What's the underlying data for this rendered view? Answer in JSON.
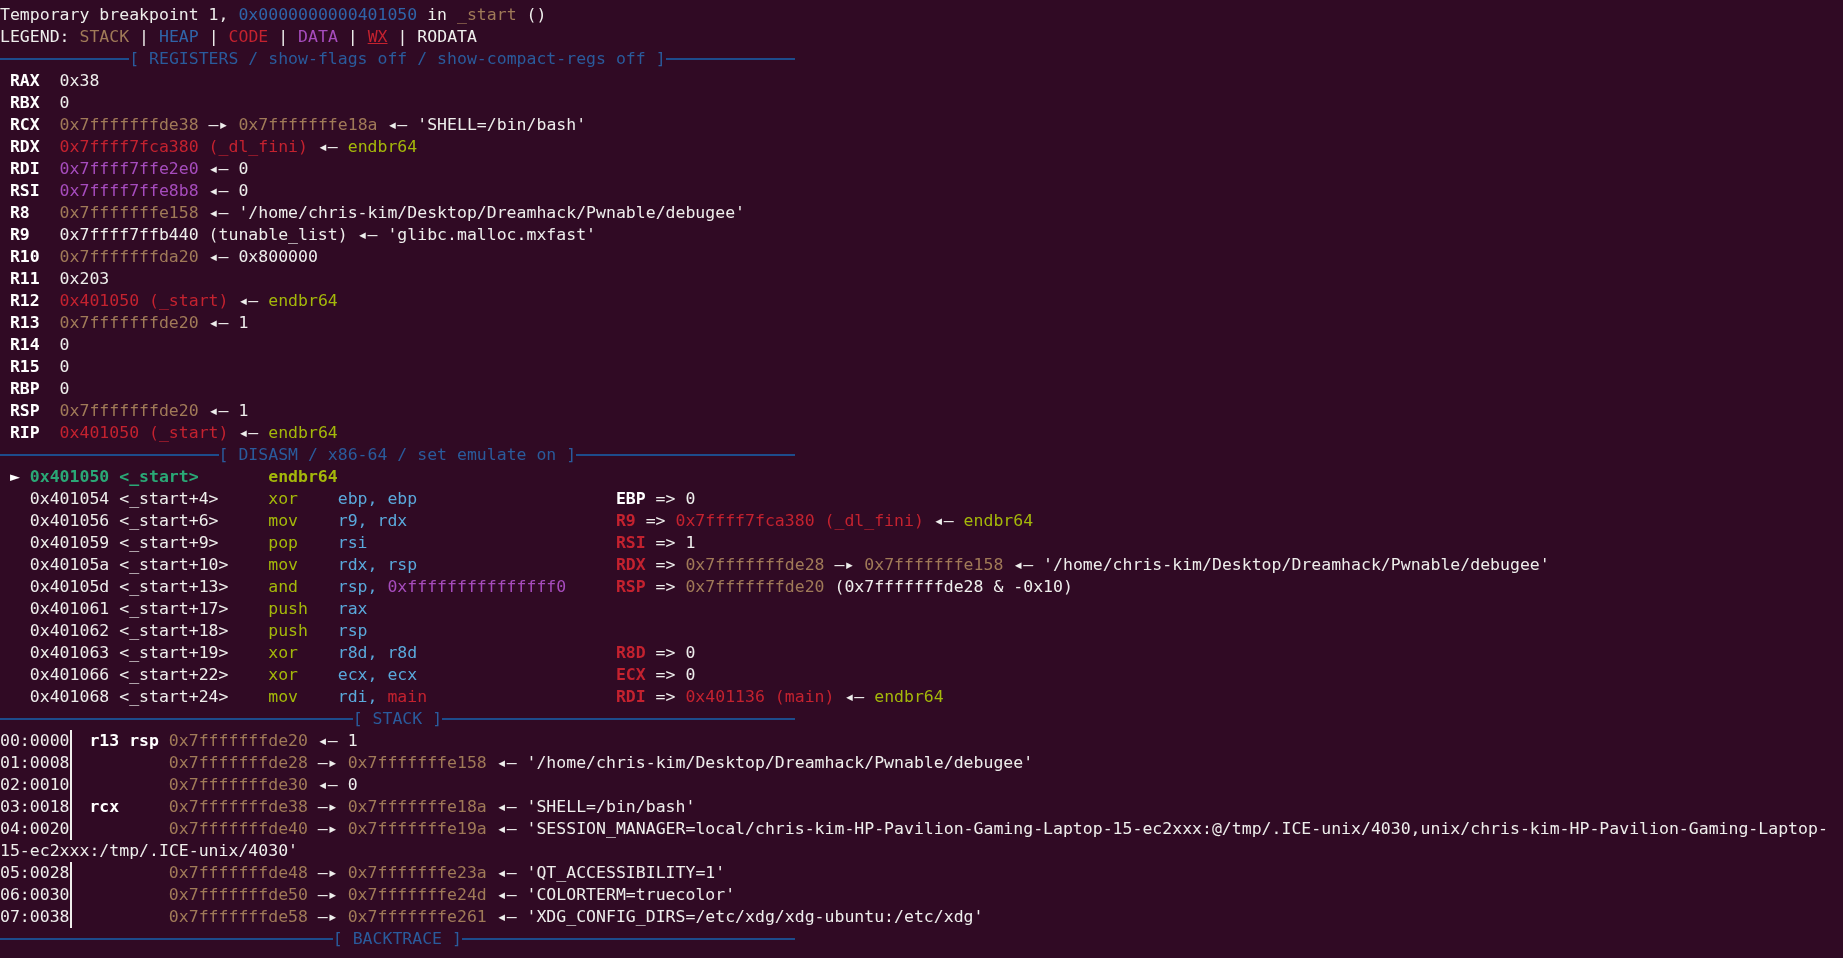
{
  "status_lines": [
    {
      "segments": [
        {
          "kind": "plain",
          "text": "Temporary breakpoint 1, "
        },
        {
          "kind": "heap",
          "text": "0x0000000000401050"
        },
        {
          "kind": "plain",
          "text": " in "
        },
        {
          "kind": "stack",
          "text": "_start"
        },
        {
          "kind": "plain",
          "text": " ()"
        }
      ]
    },
    {
      "segments": [
        {
          "kind": "plain",
          "text": "LEGEND: "
        },
        {
          "kind": "stack",
          "text": "STACK"
        },
        {
          "kind": "plain",
          "text": " | "
        },
        {
          "kind": "heap",
          "text": "HEAP"
        },
        {
          "kind": "plain",
          "text": " | "
        },
        {
          "kind": "code",
          "text": "CODE"
        },
        {
          "kind": "plain",
          "text": " | "
        },
        {
          "kind": "data",
          "text": "DATA"
        },
        {
          "kind": "plain",
          "text": " | "
        },
        {
          "kind": "wx",
          "text": "WX"
        },
        {
          "kind": "plain",
          "text": " | RODATA"
        }
      ]
    }
  ],
  "registers": {
    "title": "[ REGISTERS / show-flags off / show-compact-regs off ]",
    "rows": [
      {
        "name": "RAX",
        "value": [
          {
            "kind": "plain",
            "text": "0x38"
          }
        ]
      },
      {
        "name": "RBX",
        "value": [
          {
            "kind": "plain",
            "text": "0"
          }
        ]
      },
      {
        "name": "RCX",
        "value": [
          {
            "kind": "stack",
            "text": "0x7fffffffde38"
          },
          {
            "kind": "plain",
            "text": " —▸ "
          },
          {
            "kind": "stack",
            "text": "0x7fffffffe18a"
          },
          {
            "kind": "plain",
            "text": " ◂— 'SHELL=/bin/bash'"
          }
        ]
      },
      {
        "name": "RDX",
        "value": [
          {
            "kind": "code",
            "text": "0x7ffff7fca380 (_dl_fini)"
          },
          {
            "kind": "plain",
            "text": " ◂— "
          },
          {
            "kind": "string",
            "text": "endbr64"
          }
        ]
      },
      {
        "name": "RDI",
        "value": [
          {
            "kind": "data",
            "text": "0x7ffff7ffe2e0"
          },
          {
            "kind": "plain",
            "text": " ◂— 0"
          }
        ]
      },
      {
        "name": "RSI",
        "value": [
          {
            "kind": "data",
            "text": "0x7ffff7ffe8b8"
          },
          {
            "kind": "plain",
            "text": " ◂— 0"
          }
        ]
      },
      {
        "name": "R8",
        "value": [
          {
            "kind": "stack",
            "text": "0x7fffffffe158"
          },
          {
            "kind": "plain",
            "text": " ◂— '/home/chris-kim/Desktop/Dreamhack/Pwnable/debugee'"
          }
        ]
      },
      {
        "name": "R9",
        "value": [
          {
            "kind": "plain",
            "text": "0x7ffff7ffb440 (tunable_list) ◂— 'glibc.malloc.mxfast'"
          }
        ]
      },
      {
        "name": "R10",
        "value": [
          {
            "kind": "stack",
            "text": "0x7fffffffda20"
          },
          {
            "kind": "plain",
            "text": " ◂— 0x800000"
          }
        ]
      },
      {
        "name": "R11",
        "value": [
          {
            "kind": "plain",
            "text": "0x203"
          }
        ]
      },
      {
        "name": "R12",
        "value": [
          {
            "kind": "code",
            "text": "0x401050 (_start)"
          },
          {
            "kind": "plain",
            "text": " ◂— "
          },
          {
            "kind": "string",
            "text": "endbr64"
          }
        ]
      },
      {
        "name": "R13",
        "value": [
          {
            "kind": "stack",
            "text": "0x7fffffffde20"
          },
          {
            "kind": "plain",
            "text": " ◂— 1"
          }
        ]
      },
      {
        "name": "R14",
        "value": [
          {
            "kind": "plain",
            "text": "0"
          }
        ]
      },
      {
        "name": "R15",
        "value": [
          {
            "kind": "plain",
            "text": "0"
          }
        ]
      },
      {
        "name": "RBP",
        "value": [
          {
            "kind": "plain",
            "text": "0"
          }
        ]
      },
      {
        "name": "RSP",
        "value": [
          {
            "kind": "stack",
            "text": "0x7fffffffde20"
          },
          {
            "kind": "plain",
            "text": " ◂— 1"
          }
        ]
      },
      {
        "name": "RIP",
        "value": [
          {
            "kind": "code",
            "text": "0x401050 (_start)"
          },
          {
            "kind": "plain",
            "text": " ◂— "
          },
          {
            "kind": "string",
            "text": "endbr64"
          }
        ]
      }
    ]
  },
  "disasm": {
    "title": "[ DISASM / x86-64 / set emulate on ]",
    "rows": [
      {
        "marker": "►",
        "current": true,
        "address": "0x401050",
        "symbol": "<_start>",
        "mnemonic": "endbr64"
      },
      {
        "current": false,
        "address": "0x401054",
        "symbol": "<_start+4>",
        "mnemonic": "xor",
        "operands": [
          {
            "kind": "operand",
            "text": "ebp, ebp"
          }
        ],
        "annotation": [
          {
            "kind": "reg",
            "text": "EBP"
          },
          {
            "kind": "plain",
            "text": " => 0"
          }
        ]
      },
      {
        "current": false,
        "address": "0x401056",
        "symbol": "<_start+6>",
        "mnemonic": "mov",
        "operands": [
          {
            "kind": "operand",
            "text": "r9, rdx"
          }
        ],
        "annotation": [
          {
            "kind": "regchanged",
            "text": "R9"
          },
          {
            "kind": "plain",
            "text": " => "
          },
          {
            "kind": "code",
            "text": "0x7ffff7fca380 (_dl_fini)"
          },
          {
            "kind": "plain",
            "text": " ◂— "
          },
          {
            "kind": "string",
            "text": "endbr64"
          }
        ]
      },
      {
        "current": false,
        "address": "0x401059",
        "symbol": "<_start+9>",
        "mnemonic": "pop",
        "operands": [
          {
            "kind": "operand",
            "text": "rsi"
          }
        ],
        "annotation": [
          {
            "kind": "regchanged",
            "text": "RSI"
          },
          {
            "kind": "plain",
            "text": " => 1"
          }
        ]
      },
      {
        "current": false,
        "address": "0x40105a",
        "symbol": "<_start+10>",
        "mnemonic": "mov",
        "operands": [
          {
            "kind": "operand",
            "text": "rdx, rsp"
          }
        ],
        "annotation": [
          {
            "kind": "regchanged",
            "text": "RDX"
          },
          {
            "kind": "plain",
            "text": " => "
          },
          {
            "kind": "stack",
            "text": "0x7fffffffde28"
          },
          {
            "kind": "plain",
            "text": " —▸ "
          },
          {
            "kind": "stack",
            "text": "0x7fffffffe158"
          },
          {
            "kind": "plain",
            "text": " ◂— '/home/chris-kim/Desktop/Dreamhack/Pwnable/debugee'"
          }
        ]
      },
      {
        "current": false,
        "address": "0x40105d",
        "symbol": "<_start+13>",
        "mnemonic": "and",
        "operands": [
          {
            "kind": "operand",
            "text": "rsp, "
          },
          {
            "kind": "data",
            "text": "0xfffffffffffffff0"
          }
        ],
        "annotation": [
          {
            "kind": "regchanged",
            "text": "RSP"
          },
          {
            "kind": "plain",
            "text": " => "
          },
          {
            "kind": "stack",
            "text": "0x7fffffffde20"
          },
          {
            "kind": "plain",
            "text": " (0x7fffffffde28 & -0x10)"
          }
        ]
      },
      {
        "current": false,
        "address": "0x401061",
        "symbol": "<_start+17>",
        "mnemonic": "push",
        "operands": [
          {
            "kind": "operand",
            "text": "rax"
          }
        ]
      },
      {
        "current": false,
        "address": "0x401062",
        "symbol": "<_start+18>",
        "mnemonic": "push",
        "operands": [
          {
            "kind": "operand",
            "text": "rsp"
          }
        ]
      },
      {
        "current": false,
        "address": "0x401063",
        "symbol": "<_start+19>",
        "mnemonic": "xor",
        "operands": [
          {
            "kind": "operand",
            "text": "r8d, r8d"
          }
        ],
        "annotation": [
          {
            "kind": "regchanged",
            "text": "R8D"
          },
          {
            "kind": "plain",
            "text": " => 0"
          }
        ]
      },
      {
        "current": false,
        "address": "0x401066",
        "symbol": "<_start+22>",
        "mnemonic": "xor",
        "operands": [
          {
            "kind": "operand",
            "text": "ecx, ecx"
          }
        ],
        "annotation": [
          {
            "kind": "regchanged",
            "text": "ECX"
          },
          {
            "kind": "plain",
            "text": " => 0"
          }
        ]
      },
      {
        "current": false,
        "address": "0x401068",
        "symbol": "<_start+24>",
        "mnemonic": "mov",
        "operands": [
          {
            "kind": "operand",
            "text": "rdi, "
          },
          {
            "kind": "code",
            "text": "main"
          }
        ],
        "annotation": [
          {
            "kind": "regchanged",
            "text": "RDI"
          },
          {
            "kind": "plain",
            "text": " => "
          },
          {
            "kind": "code",
            "text": "0x401136 (main)"
          },
          {
            "kind": "plain",
            "text": " ◂— "
          },
          {
            "kind": "string",
            "text": "endbr64"
          }
        ]
      }
    ]
  },
  "stack": {
    "title": "[ STACK ]",
    "rows": [
      {
        "kind": "entry",
        "offset": "00:0000",
        "regs": "r13 rsp",
        "value": [
          {
            "kind": "stack",
            "text": "0x7fffffffde20"
          },
          {
            "kind": "plain",
            "text": " ◂— 1"
          }
        ]
      },
      {
        "kind": "entry",
        "offset": "01:0008",
        "value": [
          {
            "kind": "stack",
            "text": "0x7fffffffde28"
          },
          {
            "kind": "plain",
            "text": " —▸ "
          },
          {
            "kind": "stack",
            "text": "0x7fffffffe158"
          },
          {
            "kind": "plain",
            "text": " ◂— '/home/chris-kim/Desktop/Dreamhack/Pwnable/debugee'"
          }
        ]
      },
      {
        "kind": "entry",
        "offset": "02:0010",
        "value": [
          {
            "kind": "stack",
            "text": "0x7fffffffde30"
          },
          {
            "kind": "plain",
            "text": " ◂— 0"
          }
        ]
      },
      {
        "kind": "entry",
        "offset": "03:0018",
        "regs": "rcx",
        "value": [
          {
            "kind": "stack",
            "text": "0x7fffffffde38"
          },
          {
            "kind": "plain",
            "text": " —▸ "
          },
          {
            "kind": "stack",
            "text": "0x7fffffffe18a"
          },
          {
            "kind": "plain",
            "text": " ◂— 'SHELL=/bin/bash'"
          }
        ]
      },
      {
        "kind": "entry",
        "offset": "04:0020",
        "value": [
          {
            "kind": "stack",
            "text": "0x7fffffffde40"
          },
          {
            "kind": "plain",
            "text": " —▸ "
          },
          {
            "kind": "stack",
            "text": "0x7fffffffe19a"
          },
          {
            "kind": "plain",
            "text": " ◂— 'SESSION_MANAGER=local/chris-kim-HP-Pavilion-Gaming-Laptop-15-ec2xxx:@/tmp/.ICE-unix/4030,unix/chris-kim-HP-Pavilion-Gaming-Laptop-"
          }
        ]
      },
      {
        "kind": "wrap",
        "text": "15-ec2xxx:/tmp/.ICE-unix/4030'"
      },
      {
        "kind": "entry",
        "offset": "05:0028",
        "value": [
          {
            "kind": "stack",
            "text": "0x7fffffffde48"
          },
          {
            "kind": "plain",
            "text": " —▸ "
          },
          {
            "kind": "stack",
            "text": "0x7fffffffe23a"
          },
          {
            "kind": "plain",
            "text": " ◂— 'QT_ACCESSIBILITY=1'"
          }
        ]
      },
      {
        "kind": "entry",
        "offset": "06:0030",
        "value": [
          {
            "kind": "stack",
            "text": "0x7fffffffde50"
          },
          {
            "kind": "plain",
            "text": " —▸ "
          },
          {
            "kind": "stack",
            "text": "0x7fffffffe24d"
          },
          {
            "kind": "plain",
            "text": " ◂— 'COLORTERM=truecolor'"
          }
        ]
      },
      {
        "kind": "entry",
        "offset": "07:0038",
        "value": [
          {
            "kind": "stack",
            "text": "0x7fffffffde58"
          },
          {
            "kind": "plain",
            "text": " —▸ "
          },
          {
            "kind": "stack",
            "text": "0x7fffffffe261"
          },
          {
            "kind": "plain",
            "text": " ◂— 'XDG_CONFIG_DIRS=/etc/xdg/xdg-ubuntu:/etc/xdg'"
          }
        ]
      }
    ]
  },
  "backtrace": {
    "title": "[ BACKTRACE ]"
  }
}
